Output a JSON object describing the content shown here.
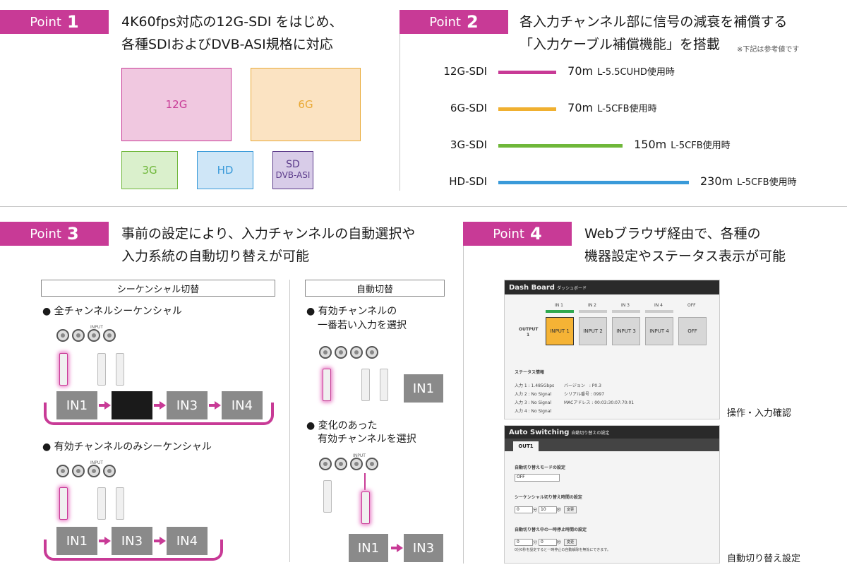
{
  "point1": {
    "badge_word": "Point",
    "badge_num": "1",
    "heading_line1": "4K60fps対応の12G-SDI をはじめ、",
    "heading_line2": "各種SDIおよびDVB-ASI規格に対応",
    "formats": [
      {
        "label": "12G",
        "color": "#c83a96"
      },
      {
        "label": "6G",
        "color": "#e9a935"
      },
      {
        "label": "3G",
        "color": "#6fb73a"
      },
      {
        "label": "HD",
        "color": "#3a9ad9"
      },
      {
        "label": "SD",
        "label2": "DVB-ASI",
        "color": "#5a3a8a"
      }
    ]
  },
  "point2": {
    "badge_word": "Point",
    "badge_num": "2",
    "heading_line1": "各入力チャンネル部に信号の減衰を補償する",
    "heading_line2": "「入力ケーブル補償機能」を搭載",
    "note": "※下記は参考値です",
    "cables": [
      {
        "label": "12G-SDI",
        "length": "70m",
        "cable": "L-5.5CUHD使用時",
        "color": "#c83a96",
        "meters": 70
      },
      {
        "label": "6G-SDI",
        "length": "70m",
        "cable": "L-5CFB使用時",
        "color": "#f0b030",
        "meters": 70
      },
      {
        "label": "3G-SDI",
        "length": "150m",
        "cable": "L-5CFB使用時",
        "color": "#6fb73a",
        "meters": 150
      },
      {
        "label": "HD-SDI",
        "length": "230m",
        "cable": "L-5CFB使用時",
        "color": "#3a9ad9",
        "meters": 230
      }
    ]
  },
  "point3": {
    "badge_word": "Point",
    "badge_num": "3",
    "heading_line1": "事前の設定により、入力チャンネルの自動選択や",
    "heading_line2": "入力系統の自動切り替えが可能",
    "sequential_tag": "シーケンシャル切替",
    "auto_tag": "自動切替",
    "seq_all": "● 全チャンネルシーケンシャル",
    "seq_valid": "● 有効チャンネルのみシーケンシャル",
    "auto_lowest_1": "● 有効チャンネルの",
    "auto_lowest_2": "一番若い入力を選択",
    "auto_change_1": "● 変化のあった",
    "auto_change_2": "有効チャンネルを選択",
    "input_label": "INPUT",
    "in1": "IN1",
    "in3": "IN3",
    "in4": "IN4"
  },
  "point4": {
    "badge_word": "Point",
    "badge_num": "4",
    "heading_line1": "Webブラウザ経由で、各種の",
    "heading_line2": "機器設定やステータス表示が可能",
    "dashboard": {
      "title": "Dash Board",
      "subtitle": "ダッシュボード",
      "inputs": [
        "IN 1",
        "IN 2",
        "IN 3",
        "IN 4",
        "OFF"
      ],
      "output_label": "OUTPUT",
      "output_num": "1",
      "tiles": [
        "INPUT 1",
        "INPUT 2",
        "INPUT 3",
        "INPUT 4",
        "OFF"
      ],
      "status_title": "ステータス情報",
      "status_left": [
        "入力 1 : 1.485Gbps",
        "入力 2 : No Signal",
        "入力 3 : No Signal",
        "入力 4 : No Signal"
      ],
      "status_right": [
        "バージョン　: P0.3",
        "シリアル番号 : 0997",
        "MACアドレス : 00:03:30:07:70:01"
      ]
    },
    "dashboard_caption": "操作・入力確認",
    "autoswitch": {
      "title": "Auto Switching",
      "subtitle": "自動切り替えの設定",
      "tab": "OUT1",
      "mode_label": "自動切り替えモードの設定",
      "mode_value": "OFF",
      "seq_label": "シーケンシャル切り替え時間の設定",
      "seq_min": "0",
      "seq_min_unit": "分",
      "seq_sec": "10",
      "seq_sec_unit": "秒",
      "seq_btn": "変更",
      "pause_label": "自動切り替え中の一時停止時間の設定",
      "pause_min": "0",
      "pause_min_unit": "分",
      "pause_sec": "0",
      "pause_sec_unit": "秒",
      "pause_btn": "変更",
      "pause_note": "0分0秒を設定すると一時停止の自動解除を無効にできます。"
    },
    "autoswitch_caption": "自動切り替え設定"
  }
}
